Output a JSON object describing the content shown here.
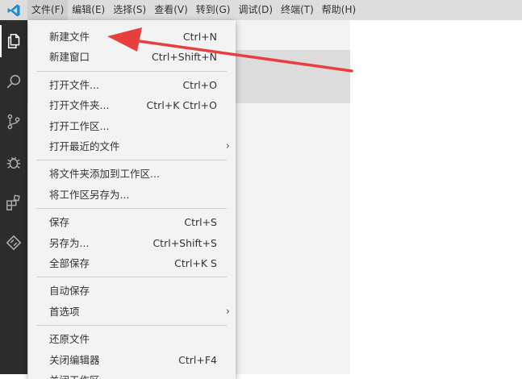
{
  "menubar": {
    "logo_icon": "vscode-logo-icon",
    "accent": "#1f8ad2",
    "items": [
      {
        "label": "文件(F)"
      },
      {
        "label": "编辑(E)"
      },
      {
        "label": "选择(S)"
      },
      {
        "label": "查看(V)"
      },
      {
        "label": "转到(G)"
      },
      {
        "label": "调试(D)"
      },
      {
        "label": "终端(T)"
      },
      {
        "label": "帮助(H)"
      }
    ]
  },
  "activitybar": {
    "icons": [
      "explorer-icon",
      "search-icon",
      "source-control-icon",
      "debug-icon",
      "extensions-icon",
      "remote-icon"
    ]
  },
  "file_menu": {
    "groups": [
      [
        {
          "label": "新建文件",
          "shortcut": "Ctrl+N"
        },
        {
          "label": "新建窗口",
          "shortcut": "Ctrl+Shift+N"
        }
      ],
      [
        {
          "label": "打开文件...",
          "shortcut": "Ctrl+O"
        },
        {
          "label": "打开文件夹...",
          "shortcut": "Ctrl+K Ctrl+O"
        },
        {
          "label": "打开工作区...",
          "shortcut": ""
        },
        {
          "label": "打开最近的文件",
          "shortcut": "",
          "submenu": true
        }
      ],
      [
        {
          "label": "将文件夹添加到工作区...",
          "shortcut": ""
        },
        {
          "label": "将工作区另存为...",
          "shortcut": ""
        }
      ],
      [
        {
          "label": "保存",
          "shortcut": "Ctrl+S"
        },
        {
          "label": "另存为...",
          "shortcut": "Ctrl+Shift+S"
        },
        {
          "label": "全部保存",
          "shortcut": "Ctrl+K S"
        }
      ],
      [
        {
          "label": "自动保存",
          "shortcut": ""
        },
        {
          "label": "首选项",
          "shortcut": "",
          "submenu": true
        }
      ],
      [
        {
          "label": "还原文件",
          "shortcut": ""
        },
        {
          "label": "关闭编辑器",
          "shortcut": "Ctrl+F4"
        },
        {
          "label": "关闭工作区",
          "shortcut": ""
        }
      ]
    ]
  },
  "annotation": {
    "color": "#e8403f"
  }
}
